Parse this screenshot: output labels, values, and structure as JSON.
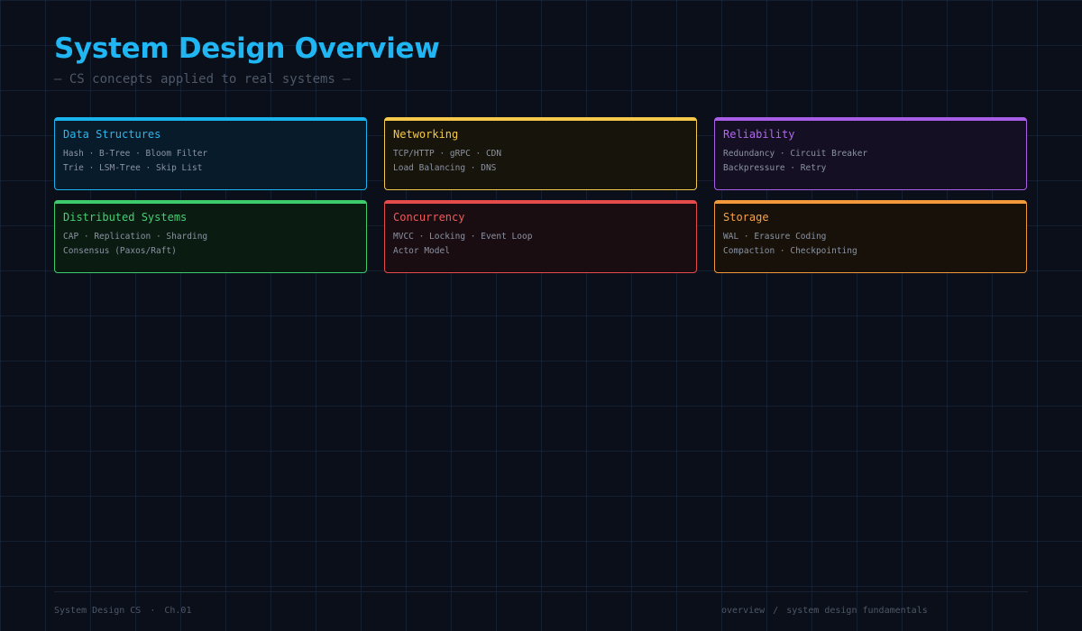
{
  "header": {
    "title": "System Design Overview",
    "subtitle": "— CS concepts applied to real systems —"
  },
  "cards": [
    {
      "title": "Data Structures",
      "accent": "#19b4ee",
      "lines": [
        "Hash · B-Tree · Bloom Filter",
        "Trie · LSM-Tree · Skip List"
      ]
    },
    {
      "title": "Networking",
      "accent": "#f6c94a",
      "lines": [
        "TCP/HTTP · gRPC · CDN",
        "Load Balancing · DNS"
      ]
    },
    {
      "title": "Reliability",
      "accent": "#a95ee8",
      "lines": [
        "Redundancy · Circuit Breaker",
        "Backpressure · Retry"
      ]
    },
    {
      "title": "Distributed Systems",
      "accent": "#3ecb6c",
      "lines": [
        "CAP · Replication · Sharding",
        "Consensus (Paxos/Raft)"
      ]
    },
    {
      "title": "Concurrency",
      "accent": "#e54b4b",
      "lines": [
        "MVCC · Locking · Event Loop",
        "Actor Model"
      ]
    },
    {
      "title": "Storage",
      "accent": "#f29a3b",
      "lines": [
        "WAL · Erasure Coding",
        "Compaction · Checkpointing"
      ]
    }
  ],
  "footer": {
    "left": "System Design CS",
    "separator": "·",
    "chapter": "Ch.01",
    "breadcrumb_section": "overview",
    "breadcrumb_separator": "/",
    "breadcrumb_topic": "system design fundamentals"
  }
}
